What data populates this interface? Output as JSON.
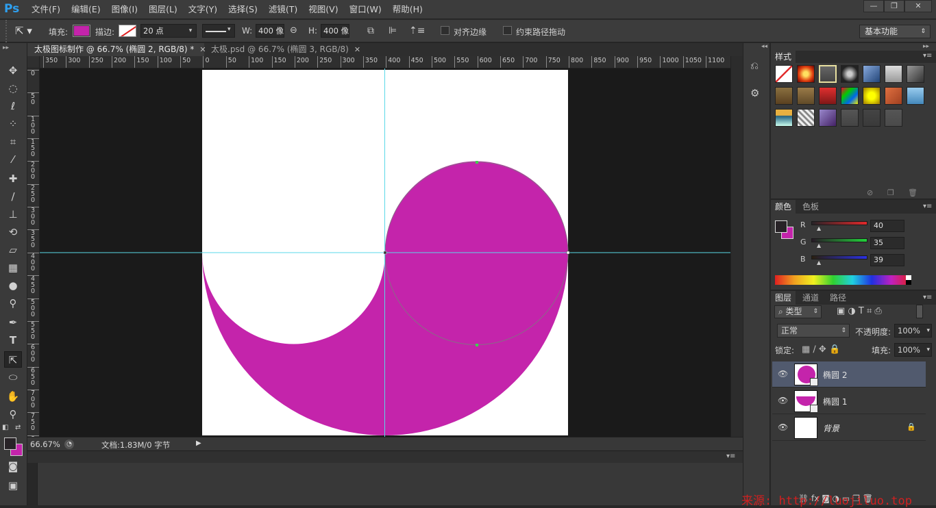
{
  "app": {
    "logo": "Ps",
    "menus": [
      "文件(F)",
      "编辑(E)",
      "图像(I)",
      "图层(L)",
      "文字(Y)",
      "选择(S)",
      "滤镜(T)",
      "视图(V)",
      "窗口(W)",
      "帮助(H)"
    ],
    "window_controls": [
      "—",
      "❐",
      "✕"
    ]
  },
  "options": {
    "fill_label": "填充:",
    "fill_color": "#c424ab",
    "stroke_label": "描边:",
    "stroke_width": "20 点",
    "w_label": "W:",
    "w_value": "400 像",
    "h_label": "H:",
    "h_value": "400 像",
    "align_edges": "对齐边缘",
    "constrain_path": "约束路径拖动",
    "workspace": "基本功能"
  },
  "tabs": [
    {
      "label": "太极图标制作 @ 66.7% (椭圆 2, RGB/8) *",
      "close": "✕"
    },
    {
      "label": "太极.psd @ 66.7% (椭圆 3, RGB/8)",
      "close": "✕"
    }
  ],
  "rulers": {
    "h_ticks": [
      "350",
      "300",
      "250",
      "200",
      "150",
      "100",
      "50",
      "0",
      "50",
      "100",
      "150",
      "200",
      "250",
      "300",
      "350",
      "400",
      "450",
      "500",
      "550",
      "600",
      "650",
      "700",
      "750",
      "800",
      "850",
      "900",
      "950",
      "1000",
      "1050",
      "1100"
    ],
    "v_ticks": [
      "0",
      "50",
      "100",
      "150",
      "200",
      "250",
      "300",
      "350",
      "400",
      "450",
      "500",
      "550",
      "600",
      "650",
      "700",
      "750",
      "800"
    ]
  },
  "status": {
    "zoom": "66.67%",
    "doc": "文档:1.83M/0 字节"
  },
  "styles_panel": {
    "tab": "样式"
  },
  "color_panel": {
    "tabs": [
      "颜色",
      "色板"
    ],
    "r_label": "R",
    "r_value": "40",
    "g_label": "G",
    "g_value": "35",
    "b_label": "B",
    "b_value": "39",
    "foreground": "#282327",
    "background": "#c424ab"
  },
  "layers_panel": {
    "tabs": [
      "图层",
      "通道",
      "路径"
    ],
    "filter_kind": "类型",
    "blend_mode": "正常",
    "opacity_label": "不透明度:",
    "opacity_value": "100%",
    "lock_label": "锁定:",
    "fill_label": "填充:",
    "fill_value": "100%",
    "layers": [
      {
        "name": "椭圆 2",
        "selected": true
      },
      {
        "name": "椭圆 1",
        "selected": false
      },
      {
        "name": "背景",
        "selected": false
      }
    ]
  },
  "watermark": "来源: http://luojiluo.top",
  "colors": {
    "shape": "#c424ab",
    "guide": "#5ad9e8"
  }
}
